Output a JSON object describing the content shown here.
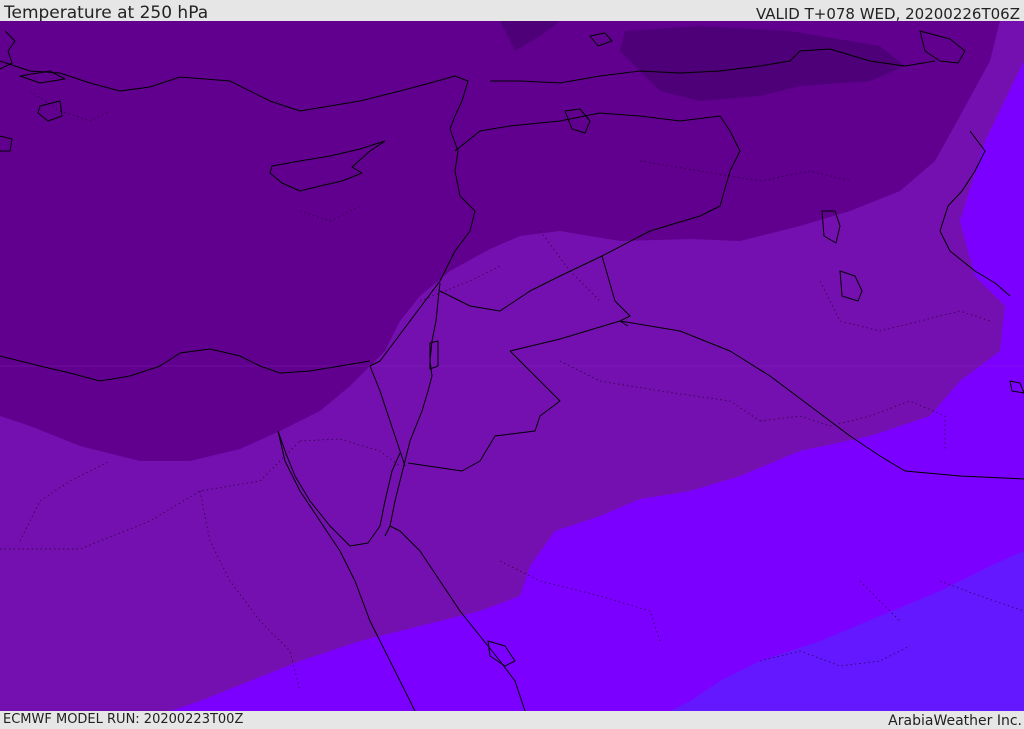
{
  "header": {
    "title": "Temperature at 250 hPa",
    "valid_time": "VALID T+078 WED, 20200226T06Z"
  },
  "footer": {
    "model_run": "ECMWF MODEL RUN: 20200223T00Z",
    "credit": "ArabiaWeather Inc."
  },
  "map": {
    "colors": {
      "darkest": "#4e0078",
      "dark": "#61008f",
      "medium": "#7510b0",
      "bright": "#7c00ff",
      "blue_violet": "#6418ff",
      "coastline": "#000000"
    }
  }
}
